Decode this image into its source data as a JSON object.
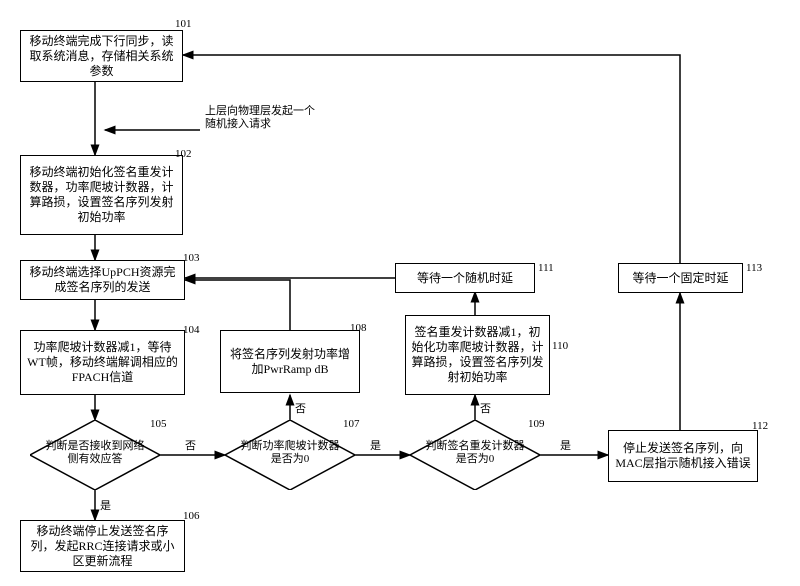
{
  "nodes": {
    "n101": {
      "id": "101",
      "text": "移动终端完成下行同步，读取系统消息，存储相关系统参数"
    },
    "n102": {
      "id": "102",
      "text": "移动终端初始化签名重发计数器，功率爬坡计数器，计算路损，设置签名序列发射初始功率"
    },
    "n103": {
      "id": "103",
      "text": "移动终端选择UpPCH资源完成签名序列的发送"
    },
    "n104": {
      "id": "104",
      "text": "功率爬坡计数器减1，等待WT帧，移动终端解调相应的FPACH信道"
    },
    "n105": {
      "id": "105",
      "text": "判断是否接收到网络侧有效应答"
    },
    "n106": {
      "id": "106",
      "text": "移动终端停止发送签名序列，发起RRC连接请求或小区更新流程"
    },
    "n107": {
      "id": "107",
      "text": "判断功率爬坡计数器是否为0"
    },
    "n108": {
      "id": "108",
      "text": "将签名序列发射功率增加PwrRamp dB"
    },
    "n109": {
      "id": "109",
      "text": "判断签名重发计数器是否为0"
    },
    "n110": {
      "id": "110",
      "text": "签名重发计数器减1，初始化功率爬坡计数器，计算路损，设置签名序列发射初始功率"
    },
    "n111": {
      "id": "111",
      "text": "等待一个随机时延"
    },
    "n112": {
      "id": "112",
      "text": "停止发送签名序列，向MAC层指示随机接入错误"
    },
    "n113": {
      "id": "113",
      "text": "等待一个固定时延"
    }
  },
  "labels": {
    "req": "上层向物理层发起一个随机接入请求",
    "yes": "是",
    "no": "否"
  },
  "chart_data": {
    "type": "flowchart",
    "nodes": [
      {
        "id": 101,
        "shape": "process",
        "text": "移动终端完成下行同步，读取系统消息，存储相关系统参数"
      },
      {
        "id": 102,
        "shape": "process",
        "text": "移动终端初始化签名重发计数器，功率爬坡计数器，计算路损，设置签名序列发射初始功率"
      },
      {
        "id": 103,
        "shape": "process",
        "text": "移动终端选择UpPCH资源完成签名序列的发送"
      },
      {
        "id": 104,
        "shape": "process",
        "text": "功率爬坡计数器减1，等待WT帧，移动终端解调相应的FPACH信道"
      },
      {
        "id": 105,
        "shape": "decision",
        "text": "判断是否接收到网络侧有效应答"
      },
      {
        "id": 106,
        "shape": "process",
        "text": "移动终端停止发送签名序列，发起RRC连接请求或小区更新流程"
      },
      {
        "id": 107,
        "shape": "decision",
        "text": "判断功率爬坡计数器是否为0"
      },
      {
        "id": 108,
        "shape": "process",
        "text": "将签名序列发射功率增加PwrRamp dB"
      },
      {
        "id": 109,
        "shape": "decision",
        "text": "判断签名重发计数器是否为0"
      },
      {
        "id": 110,
        "shape": "process",
        "text": "签名重发计数器减1，初始化功率爬坡计数器，计算路损，设置签名序列发射初始功率"
      },
      {
        "id": 111,
        "shape": "process",
        "text": "等待一个随机时延"
      },
      {
        "id": 112,
        "shape": "process",
        "text": "停止发送签名序列，向MAC层指示随机接入错误"
      },
      {
        "id": 113,
        "shape": "process",
        "text": "等待一个固定时延"
      }
    ],
    "edges": [
      {
        "from": 101,
        "to": 102,
        "label": "上层向物理层发起一个随机接入请求"
      },
      {
        "from": 102,
        "to": 103
      },
      {
        "from": 103,
        "to": 104
      },
      {
        "from": 104,
        "to": 105
      },
      {
        "from": 105,
        "to": 106,
        "label": "是"
      },
      {
        "from": 105,
        "to": 107,
        "label": "否"
      },
      {
        "from": 107,
        "to": 108,
        "label": "否"
      },
      {
        "from": 108,
        "to": 103
      },
      {
        "from": 107,
        "to": 109,
        "label": "是"
      },
      {
        "from": 109,
        "to": 110,
        "label": "否"
      },
      {
        "from": 110,
        "to": 111
      },
      {
        "from": 111,
        "to": 103
      },
      {
        "from": 109,
        "to": 112,
        "label": "是"
      },
      {
        "from": 112,
        "to": 113
      },
      {
        "from": 113,
        "to": 101
      }
    ]
  }
}
